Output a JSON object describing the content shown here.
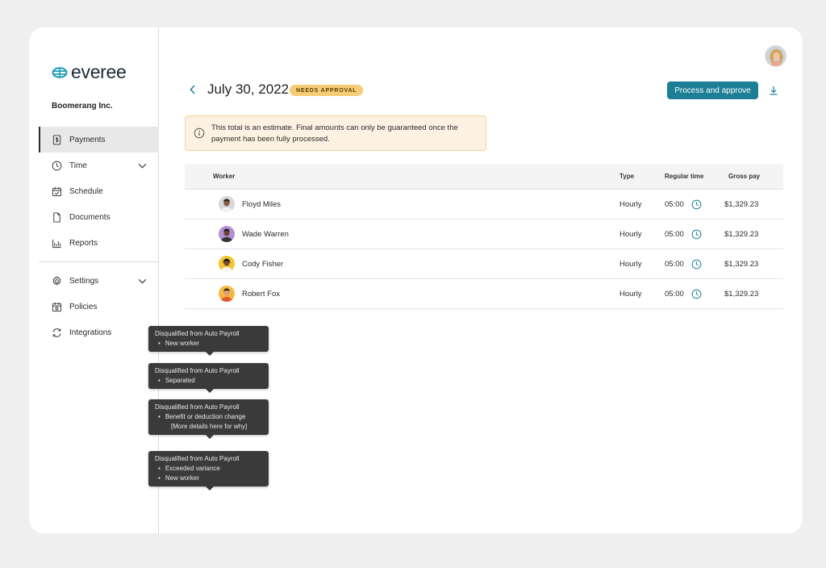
{
  "brand": {
    "logo_text": "everee",
    "company": "Boomerang Inc."
  },
  "nav": {
    "primary": [
      {
        "label": "Payments",
        "icon": "receipt-icon",
        "active": true
      },
      {
        "label": "Time",
        "icon": "clock-icon",
        "expandable": true
      },
      {
        "label": "Schedule",
        "icon": "calendar-check-icon"
      },
      {
        "label": "Documents",
        "icon": "document-icon"
      },
      {
        "label": "Reports",
        "icon": "bar-chart-icon"
      }
    ],
    "secondary": [
      {
        "label": "Settings",
        "icon": "gear-icon",
        "expandable": true
      },
      {
        "label": "Policies",
        "icon": "policy-calendar-icon"
      },
      {
        "label": "Integrations",
        "icon": "sync-icon"
      }
    ]
  },
  "header": {
    "title": "July 30, 2022",
    "badge": "NEEDS APPROVAL",
    "primary_button": "Process and approve"
  },
  "notice": {
    "text": "This total is an estimate. Final amounts can only be guaranteed once the payment has been fully processed."
  },
  "table": {
    "columns": {
      "worker": "Worker",
      "type": "Type",
      "regular_time": "Regular time",
      "gross_pay": "Gross pay"
    },
    "rows": [
      {
        "name": "Floyd Miles",
        "type": "Hourly",
        "regular_time": "05:00",
        "gross_pay": "$1,329.23"
      },
      {
        "name": "Wade Warren",
        "type": "Hourly",
        "regular_time": "05:00",
        "gross_pay": "$1,329.23"
      },
      {
        "name": "Cody Fisher",
        "type": "Hourly",
        "regular_time": "05:00",
        "gross_pay": "$1,329.23"
      },
      {
        "name": "Robert Fox",
        "type": "Hourly",
        "regular_time": "05:00",
        "gross_pay": "$1,329.23"
      }
    ]
  },
  "tooltips": [
    {
      "title": "Disqualified from Auto Payroll",
      "items": [
        "New worker"
      ]
    },
    {
      "title": "Disqualified from Auto Payroll",
      "items": [
        "Separated"
      ]
    },
    {
      "title": "Disqualified from Auto Payroll",
      "items": [
        "Benefit or deduction change"
      ],
      "extra": "[More details here for why]"
    },
    {
      "title": "Disqualified from Auto Payroll",
      "items": [
        "Exceeded variance",
        "New worker"
      ]
    }
  ],
  "colors": {
    "accent": "#1c7f95",
    "badge_bg": "#f6cc75",
    "notice_bg": "#fdf2e2",
    "notice_border": "#f5d29a",
    "tooltip_bg": "#3a3a3a"
  }
}
